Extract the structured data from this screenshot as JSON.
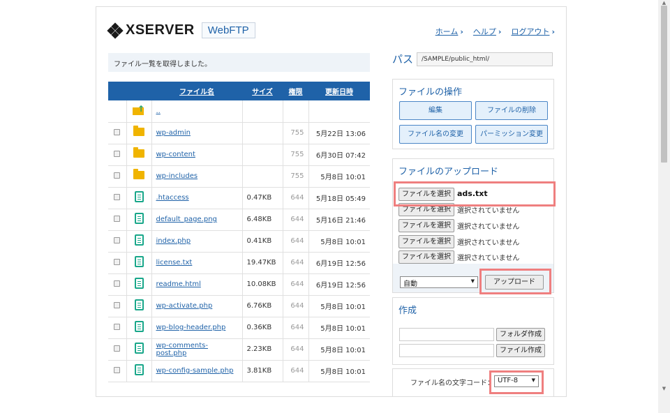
{
  "brand": {
    "name": "XSERVER",
    "product": "WebFTP"
  },
  "nav": {
    "home": "ホーム",
    "help": "ヘルプ",
    "logout": "ログアウト"
  },
  "status_message": "ファイル一覧を取得しました。",
  "table": {
    "headers": {
      "name": "ファイル名",
      "size": "サイズ",
      "perm": "権限",
      "date": "更新日時"
    },
    "parent": "..",
    "rows": [
      {
        "type": "folder",
        "name": "wp-admin",
        "size": "",
        "perm": "755",
        "date": "5月22日 13:06"
      },
      {
        "type": "folder",
        "name": "wp-content",
        "size": "",
        "perm": "755",
        "date": "6月30日 07:42"
      },
      {
        "type": "folder",
        "name": "wp-includes",
        "size": "",
        "perm": "755",
        "date": "5月8日 10:01"
      },
      {
        "type": "file",
        "name": ".htaccess",
        "size": "0.47KB",
        "perm": "644",
        "date": "5月18日 05:49"
      },
      {
        "type": "file",
        "name": "default_page.png",
        "size": "6.48KB",
        "perm": "644",
        "date": "5月16日 21:46"
      },
      {
        "type": "file",
        "name": "index.php",
        "size": "0.41KB",
        "perm": "644",
        "date": "5月8日 10:01"
      },
      {
        "type": "file",
        "name": "license.txt",
        "size": "19.47KB",
        "perm": "644",
        "date": "6月19日 12:56"
      },
      {
        "type": "file",
        "name": "readme.html",
        "size": "10.08KB",
        "perm": "644",
        "date": "6月19日 12:56"
      },
      {
        "type": "file",
        "name": "wp-activate.php",
        "size": "6.76KB",
        "perm": "644",
        "date": "5月8日 10:01"
      },
      {
        "type": "file",
        "name": "wp-blog-header.php",
        "size": "0.36KB",
        "perm": "644",
        "date": "5月8日 10:01"
      },
      {
        "type": "file",
        "name": "wp-comments-post.php",
        "size": "2.23KB",
        "perm": "644",
        "date": "5月8日 10:01"
      },
      {
        "type": "file",
        "name": "wp-config-sample.php",
        "size": "3.81KB",
        "perm": "644",
        "date": "5月8日 10:01"
      }
    ]
  },
  "path": {
    "label": "パス",
    "value": "/SAMPLE/public_html/"
  },
  "ops": {
    "title": "ファイルの操作",
    "edit": "編集",
    "delete": "ファイルの削除",
    "rename": "ファイル名の変更",
    "permission": "パーミッション変更"
  },
  "upload": {
    "title": "ファイルのアップロード",
    "choose": "ファイルを選択",
    "chosen_file": "ads.txt",
    "no_file": "選択されていません",
    "mode": "自動",
    "submit": "アップロード"
  },
  "create": {
    "title": "作成",
    "folder_button": "フォルダ作成",
    "file_button": "ファイル作成"
  },
  "encoding": {
    "label": "ファイル名の文字コード：",
    "value": "UTF-8"
  },
  "colors": {
    "accent": "#1f62a8",
    "highlight": "#ef7f7f",
    "folder": "#f0b400",
    "file_icon": "#19a78a"
  }
}
